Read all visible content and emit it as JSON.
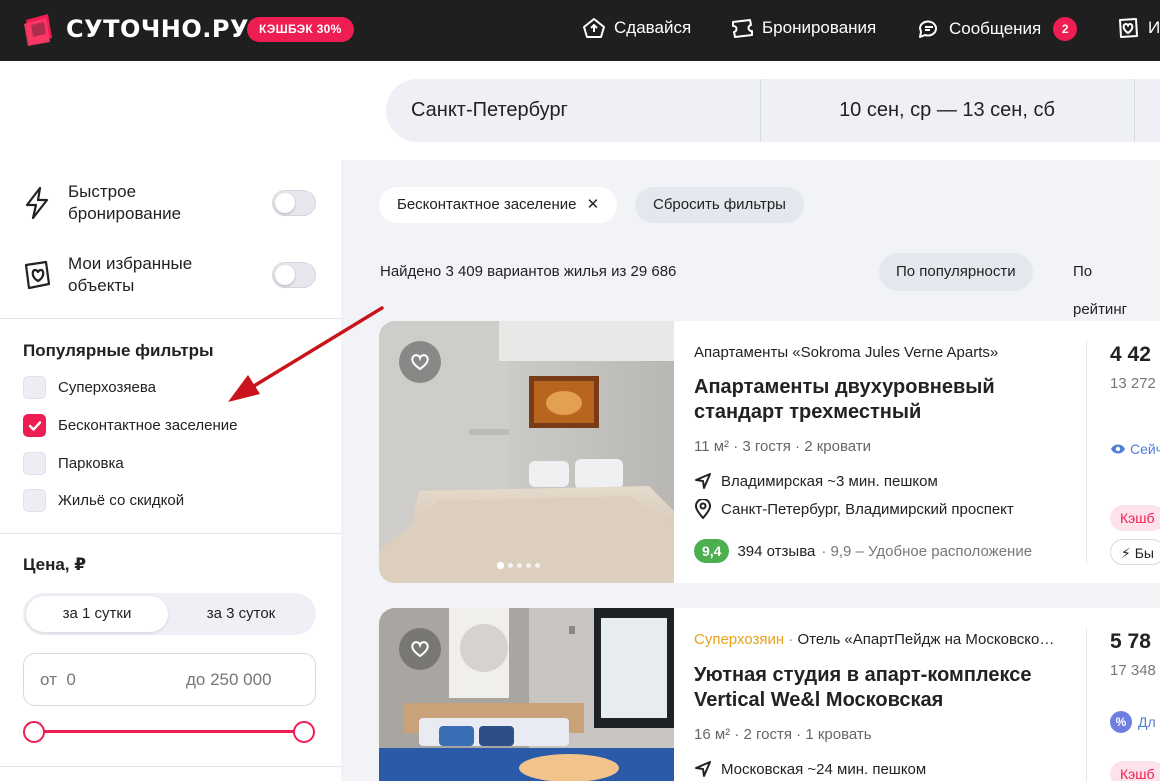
{
  "header": {
    "logo_text": "СУТОЧНО.РУ",
    "cashback_badge": "КЭШБЭК 30%",
    "nav": [
      {
        "label": "Сдавайся",
        "icon": "house-upload-icon"
      },
      {
        "label": "Бронирования",
        "icon": "ticket-icon"
      },
      {
        "label": "Сообщения",
        "icon": "chat-bubbles-icon",
        "badge": "2"
      },
      {
        "label": "И",
        "icon": "heart-badge-icon"
      }
    ],
    "accent_color": "#ee1d52"
  },
  "search": {
    "city": "Санкт-Петербург",
    "dates": "10 сен, ср — 13 сен, сб"
  },
  "sidebar": {
    "toggles": [
      {
        "label": "Быстрое бронирование",
        "icon": "lightning-icon",
        "on": false
      },
      {
        "label": "Мои избранные объекты",
        "icon": "heart-badge-icon",
        "on": false
      }
    ],
    "popular_title": "Популярные фильтры",
    "checkboxes": [
      {
        "label": "Суперхозяева",
        "checked": false
      },
      {
        "label": "Бесконтактное заселение",
        "checked": true
      },
      {
        "label": "Парковка",
        "checked": false
      },
      {
        "label": "Жильё со скидкой",
        "checked": false
      }
    ],
    "price_title": "Цена, ₽",
    "price_period": [
      "за 1 сутки",
      "за 3 суток"
    ],
    "price_period_selected": "за 1 сутки",
    "price_from_value": "от  0",
    "price_to_value": "до 250 000"
  },
  "main": {
    "active_filter_chip": "Бесконтактное заселение",
    "reset_chip": "Сбросить фильтры",
    "found_text": "Найдено 3 409 вариантов жилья из 29 686",
    "sort": [
      "По популярности",
      "По рейтинг"
    ],
    "sort_selected": "По популярности",
    "listings": [
      {
        "type": "Апартаменты «Sokroma Jules Verne Aparts»",
        "title": "Апартаменты двухуровневый стандарт трехместный",
        "area": "11 м²",
        "guests": "3 гостя",
        "beds": "2 кровати",
        "metro": "Владимирская ~3 мин. пешком",
        "address": "Санкт-Петербург, Владимирский проспект",
        "rating": "9,4",
        "reviews": "394 отзыва",
        "rating_note": "9,9 – Удобное расположение",
        "price": "4 42",
        "price_total": "13 272",
        "note": "Сейч",
        "badge_pink": "Кэшб",
        "badge_outline": "Бы"
      },
      {
        "host": "Суперхозяин",
        "type": "Отель «АпартПейдж на Московской»",
        "title": "Уютная студия в апарт-комплексе Vertical We&l Московская",
        "area": "16 м²",
        "guests": "2 гостя",
        "beds": "1 кровать",
        "metro": "Московская ~24 мин. пешком",
        "price": "5 78",
        "price_total": "17 348",
        "note": "Дл",
        "badge_pink": "Кэшб"
      }
    ]
  }
}
